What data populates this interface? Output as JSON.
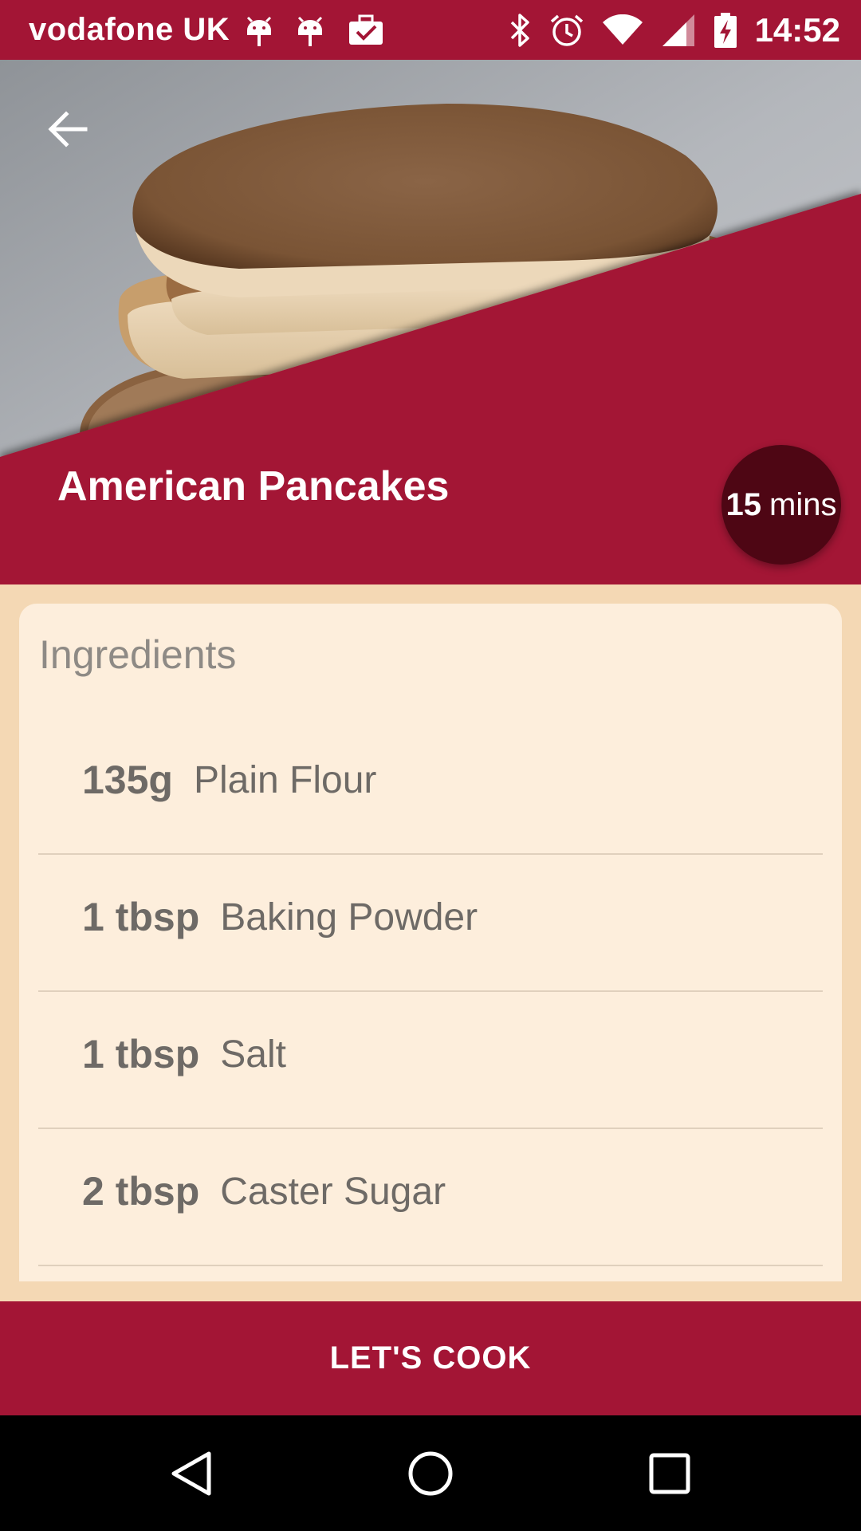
{
  "status_bar": {
    "carrier": "vodafone UK",
    "time": "14:52",
    "left_icons": [
      "android-icon",
      "android-icon",
      "briefcase-check-icon"
    ],
    "right_icons": [
      "bluetooth-icon",
      "alarm-icon",
      "wifi-icon",
      "signal-icon",
      "battery-charging-icon"
    ]
  },
  "hero": {
    "image": "pancake-stack-photo",
    "back_icon": "arrow-left-icon"
  },
  "recipe": {
    "title": "American Pancakes",
    "time_value": "15",
    "time_unit": "mins"
  },
  "ingredients": {
    "heading": "Ingredients",
    "items": [
      {
        "qty": "135g",
        "name": "Plain Flour"
      },
      {
        "qty": "1 tbsp",
        "name": "Baking Powder"
      },
      {
        "qty": "1 tbsp",
        "name": "Salt"
      },
      {
        "qty": "2 tbsp",
        "name": "Caster Sugar"
      }
    ]
  },
  "actions": {
    "cook_label": "LET'S COOK"
  },
  "nav_bar": {
    "icons": [
      "back-triangle-icon",
      "home-circle-icon",
      "recents-square-icon"
    ]
  },
  "colors": {
    "primary": "#a31535",
    "badge": "#4e0614",
    "card": "#fdeedc",
    "background": "#f4d8b4"
  }
}
